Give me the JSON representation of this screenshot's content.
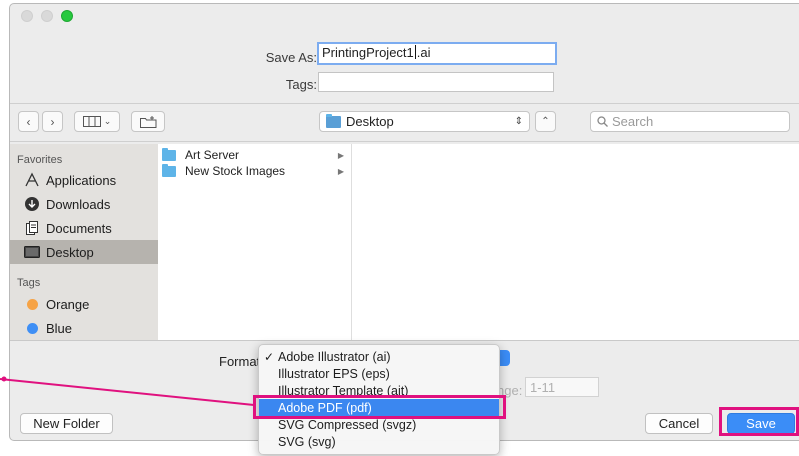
{
  "colors": {
    "accent": "#3b8df7",
    "annotation": "#e0117f",
    "green_light": "#27c93f",
    "folder": "#5eb4e8"
  },
  "window": {
    "traffic_lights": [
      "close",
      "minimize",
      "zoom"
    ]
  },
  "save_as": {
    "label": "Save As:",
    "value_before_caret": "PrintingProject1",
    "value_after_caret": ".ai"
  },
  "tags": {
    "label": "Tags:",
    "value": ""
  },
  "toolbar": {
    "back_icon": "chevron-left-icon",
    "forward_icon": "chevron-right-icon",
    "view_icon": "column-view-icon",
    "new_folder_icon": "new-folder-icon",
    "location": "Desktop",
    "expand_icon": "chevron-up-icon",
    "search_placeholder": "Search"
  },
  "sidebar": {
    "favorites_heading": "Favorites",
    "favorites": [
      {
        "label": "Applications",
        "icon": "applications-icon"
      },
      {
        "label": "Downloads",
        "icon": "downloads-icon"
      },
      {
        "label": "Documents",
        "icon": "documents-icon"
      },
      {
        "label": "Desktop",
        "icon": "desktop-icon",
        "selected": true
      }
    ],
    "tags_heading": "Tags",
    "tags": [
      {
        "label": "Orange",
        "color": "#f6a346"
      },
      {
        "label": "Blue",
        "color": "#3f8ff5"
      }
    ]
  },
  "browser": {
    "items": [
      {
        "name": "Art Server"
      },
      {
        "name": "New Stock Images"
      }
    ]
  },
  "format": {
    "label": "Format",
    "options": [
      "Adobe Illustrator (ai)",
      "Illustrator EPS (eps)",
      "Illustrator Template (ait)",
      "Adobe PDF (pdf)",
      "SVG Compressed (svgz)",
      "SVG (svg)"
    ],
    "checked": "Adobe Illustrator (ai)",
    "highlighted": "Adobe PDF (pdf)"
  },
  "range": {
    "label_fragment": "nge:",
    "value": "1-11"
  },
  "buttons": {
    "new_folder": "New Folder",
    "cancel": "Cancel",
    "save": "Save"
  }
}
